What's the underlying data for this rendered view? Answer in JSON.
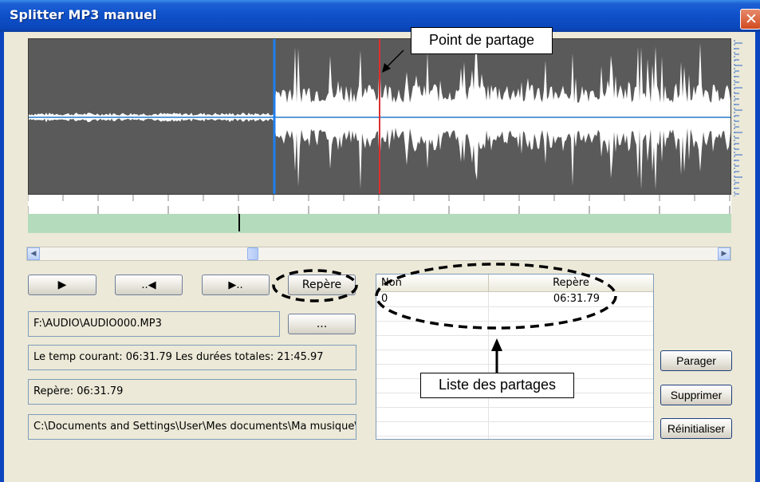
{
  "window": {
    "title": "Splitter MP3 manuel",
    "close_icon": "close-icon",
    "colors": {
      "titlebar": "#0f50c8",
      "body": "#ece9d8",
      "waveform_bg": "#5a5a5a",
      "split_marker": "#e03030",
      "cursor_marker": "#1e7ff0",
      "timeline": "#b4dcbc"
    }
  },
  "waveform": {
    "start_marker_fraction": 0.35,
    "split_marker_fraction": 0.5
  },
  "scrollbar": {
    "thumb_fraction": 0.31,
    "left_icon": "scroll-left-arrow-icon",
    "right_icon": "scroll-right-arrow-icon"
  },
  "controls": {
    "play_icon": "play-icon",
    "prev_icon": "previous-icon",
    "next_icon": "next-icon",
    "mark_label": "Repère",
    "browse_label": "...",
    "file_path": "F:\\AUDIO\\AUDIO000.MP3",
    "time_info": "Le temp courant: 06:31.79  Les durées totales: 21:45.97",
    "mark_info": "Repère: 06:31.79",
    "output_path": "C:\\Documents and Settings\\User\\Mes documents\\Ma musique\\I"
  },
  "list": {
    "columns": [
      "Non",
      "Repère"
    ],
    "rows": [
      {
        "non": "0",
        "repere": "06:31.79"
      }
    ]
  },
  "actions": {
    "split_label": "Parager",
    "delete_label": "Supprimer",
    "reset_label": "Réinitialiser"
  },
  "annotations": {
    "split_point": "Point de partage",
    "split_list": "Liste des partages"
  }
}
